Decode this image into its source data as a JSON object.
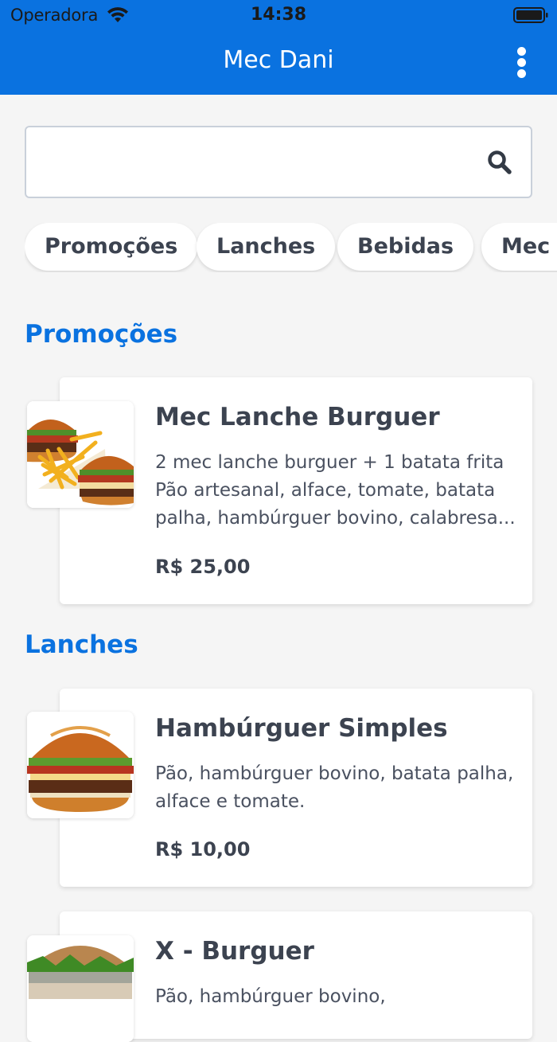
{
  "status_bar": {
    "carrier": "Operadora",
    "time": "14:38"
  },
  "header": {
    "title": "Mec Dani",
    "menu_icon": "more-vertical-icon",
    "background_color": "#0a72e0"
  },
  "search": {
    "value": "",
    "placeholder": "",
    "icon": "search-icon"
  },
  "categories": [
    "Promoções",
    "Lanches",
    "Bebidas",
    "Mec N"
  ],
  "sections": [
    {
      "title": "Promoções",
      "items": [
        {
          "name": "Mec Lanche Burguer",
          "description": "2 mec lanche burguer + 1 batata frita Pão artesanal, alface, tomate, batata palha, hambúrguer bovino, calabresa...",
          "price": "R$ 25,00",
          "image": "burger-fries-combo-image"
        }
      ]
    },
    {
      "title": "Lanches",
      "items": [
        {
          "name": "Hambúrguer Simples",
          "description": "Pão, hambúrguer bovino, batata palha, alface e tomate.",
          "price": "R$ 10,00",
          "image": "burger-image"
        },
        {
          "name": "X - Burguer",
          "description": "Pão, hambúrguer bovino, ",
          "price": "",
          "image": "x-burger-image"
        }
      ]
    }
  ],
  "colors": {
    "accent": "#0a72e0",
    "text": "#3c4350",
    "background": "#f5f5f5"
  }
}
